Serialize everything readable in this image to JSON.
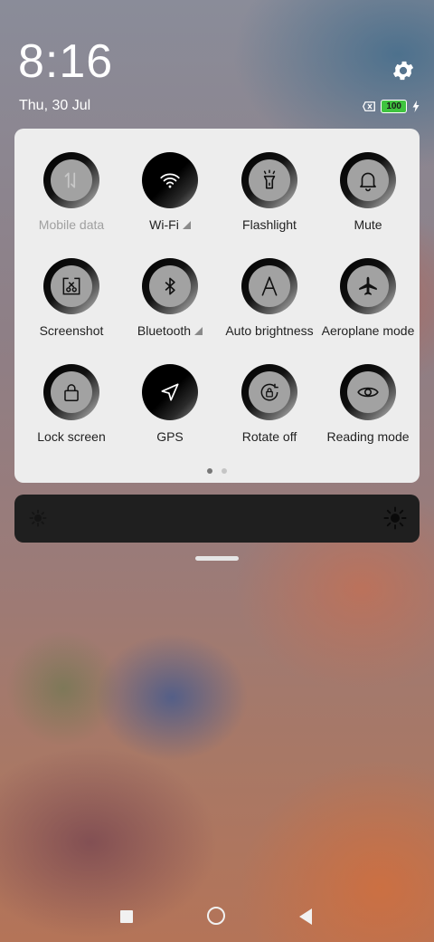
{
  "status": {
    "time": "8:16",
    "date": "Thu, 30 Jul",
    "battery_level": "100",
    "battery_color": "#3fc43f",
    "icons": [
      "gear-icon",
      "sim-off-icon",
      "battery-icon",
      "charging-bolt-icon"
    ]
  },
  "tiles": [
    {
      "label": "Mobile data",
      "icon": "mobile-data-icon",
      "state": "off",
      "signal": false,
      "dim": true
    },
    {
      "label": "Wi-Fi",
      "icon": "wifi-icon",
      "state": "on",
      "signal": true
    },
    {
      "label": "Flashlight",
      "icon": "flashlight-icon",
      "state": "off",
      "signal": false
    },
    {
      "label": "Mute",
      "icon": "bell-icon",
      "state": "off",
      "signal": false
    },
    {
      "label": "Screenshot",
      "icon": "screenshot-icon",
      "state": "off",
      "signal": false
    },
    {
      "label": "Bluetooth",
      "icon": "bluetooth-icon",
      "state": "off",
      "signal": true
    },
    {
      "label": "Auto brightness",
      "icon": "auto-brightness-icon",
      "state": "off",
      "signal": false
    },
    {
      "label": "Aeroplane mode",
      "icon": "airplane-icon",
      "state": "off",
      "signal": false
    },
    {
      "label": "Lock screen",
      "icon": "lock-icon",
      "state": "off",
      "signal": false
    },
    {
      "label": "GPS",
      "icon": "location-arrow-icon",
      "state": "on",
      "signal": false
    },
    {
      "label": "Rotate off",
      "icon": "rotate-lock-icon",
      "state": "off",
      "signal": false
    },
    {
      "label": "Reading mode",
      "icon": "eye-icon",
      "state": "off",
      "signal": false
    }
  ],
  "pager": {
    "pages": 2,
    "current": 1
  },
  "brightness": {
    "level": 0,
    "icons": [
      "sun-small-icon",
      "sun-large-icon"
    ]
  },
  "navbar": {
    "buttons": [
      "recents-button",
      "home-button",
      "back-button"
    ]
  }
}
